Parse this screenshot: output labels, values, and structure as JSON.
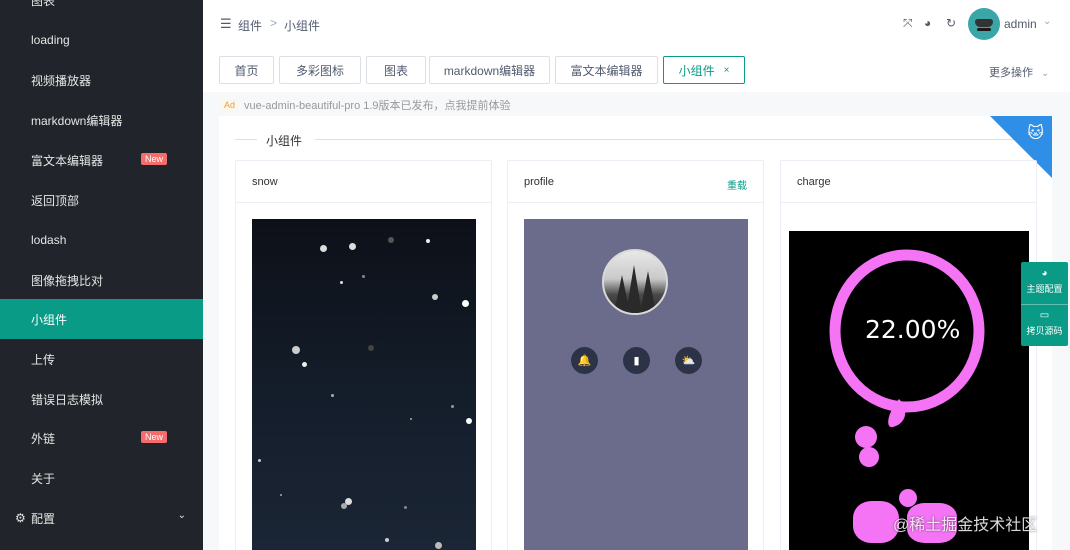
{
  "sidebar": {
    "items": [
      {
        "label": "图表"
      },
      {
        "label": "loading"
      },
      {
        "label": "视频播放器"
      },
      {
        "label": "markdown编辑器"
      },
      {
        "label": "富文本编辑器",
        "badge": "New"
      },
      {
        "label": "返回顶部"
      },
      {
        "label": "lodash"
      },
      {
        "label": "图像拖拽比对"
      },
      {
        "label": "小组件",
        "active": true
      },
      {
        "label": "上传"
      },
      {
        "label": "错误日志模拟"
      },
      {
        "label": "外链",
        "badge": "New"
      },
      {
        "label": "关于"
      },
      {
        "label": "配置"
      }
    ]
  },
  "header": {
    "breadcrumb": [
      "组件",
      "小组件"
    ],
    "breadcrumb_sep": ">",
    "username": "admin",
    "tabs": [
      {
        "label": "首页"
      },
      {
        "label": "多彩图标"
      },
      {
        "label": "图表"
      },
      {
        "label": "markdown编辑器"
      },
      {
        "label": "富文本编辑器"
      },
      {
        "label": "小组件",
        "active": true,
        "close": "×"
      }
    ],
    "more_actions": "更多操作"
  },
  "ad": {
    "tag": "Ad",
    "text": "vue-admin-beautiful-pro 1.9版本已发布，点我提前体验"
  },
  "main": {
    "divider_title": "小组件",
    "cards": [
      {
        "title": "snow"
      },
      {
        "title": "profile",
        "action": "重载"
      },
      {
        "title": "charge",
        "value": "22.00%"
      }
    ]
  },
  "float_panel": {
    "theme_label": "主题配置",
    "copy_label": "拷贝源码"
  },
  "watermark": "@稀土掘金技术社区",
  "colors": {
    "sidebar_bg": "#21252b",
    "accent": "#0a9b86",
    "badge_red": "#f56c6c",
    "corner_blue": "#2f8ee5",
    "charge_pink": "#f573f5",
    "profile_bg": "#6b6b8b"
  },
  "icons": {
    "fold": "menu-fold-icon",
    "fullscreen": "fullscreen-icon",
    "theme": "palette-icon",
    "refresh": "refresh-icon",
    "profile_buttons": [
      "bell-icon",
      "bookmark-icon",
      "weather-icon"
    ]
  }
}
